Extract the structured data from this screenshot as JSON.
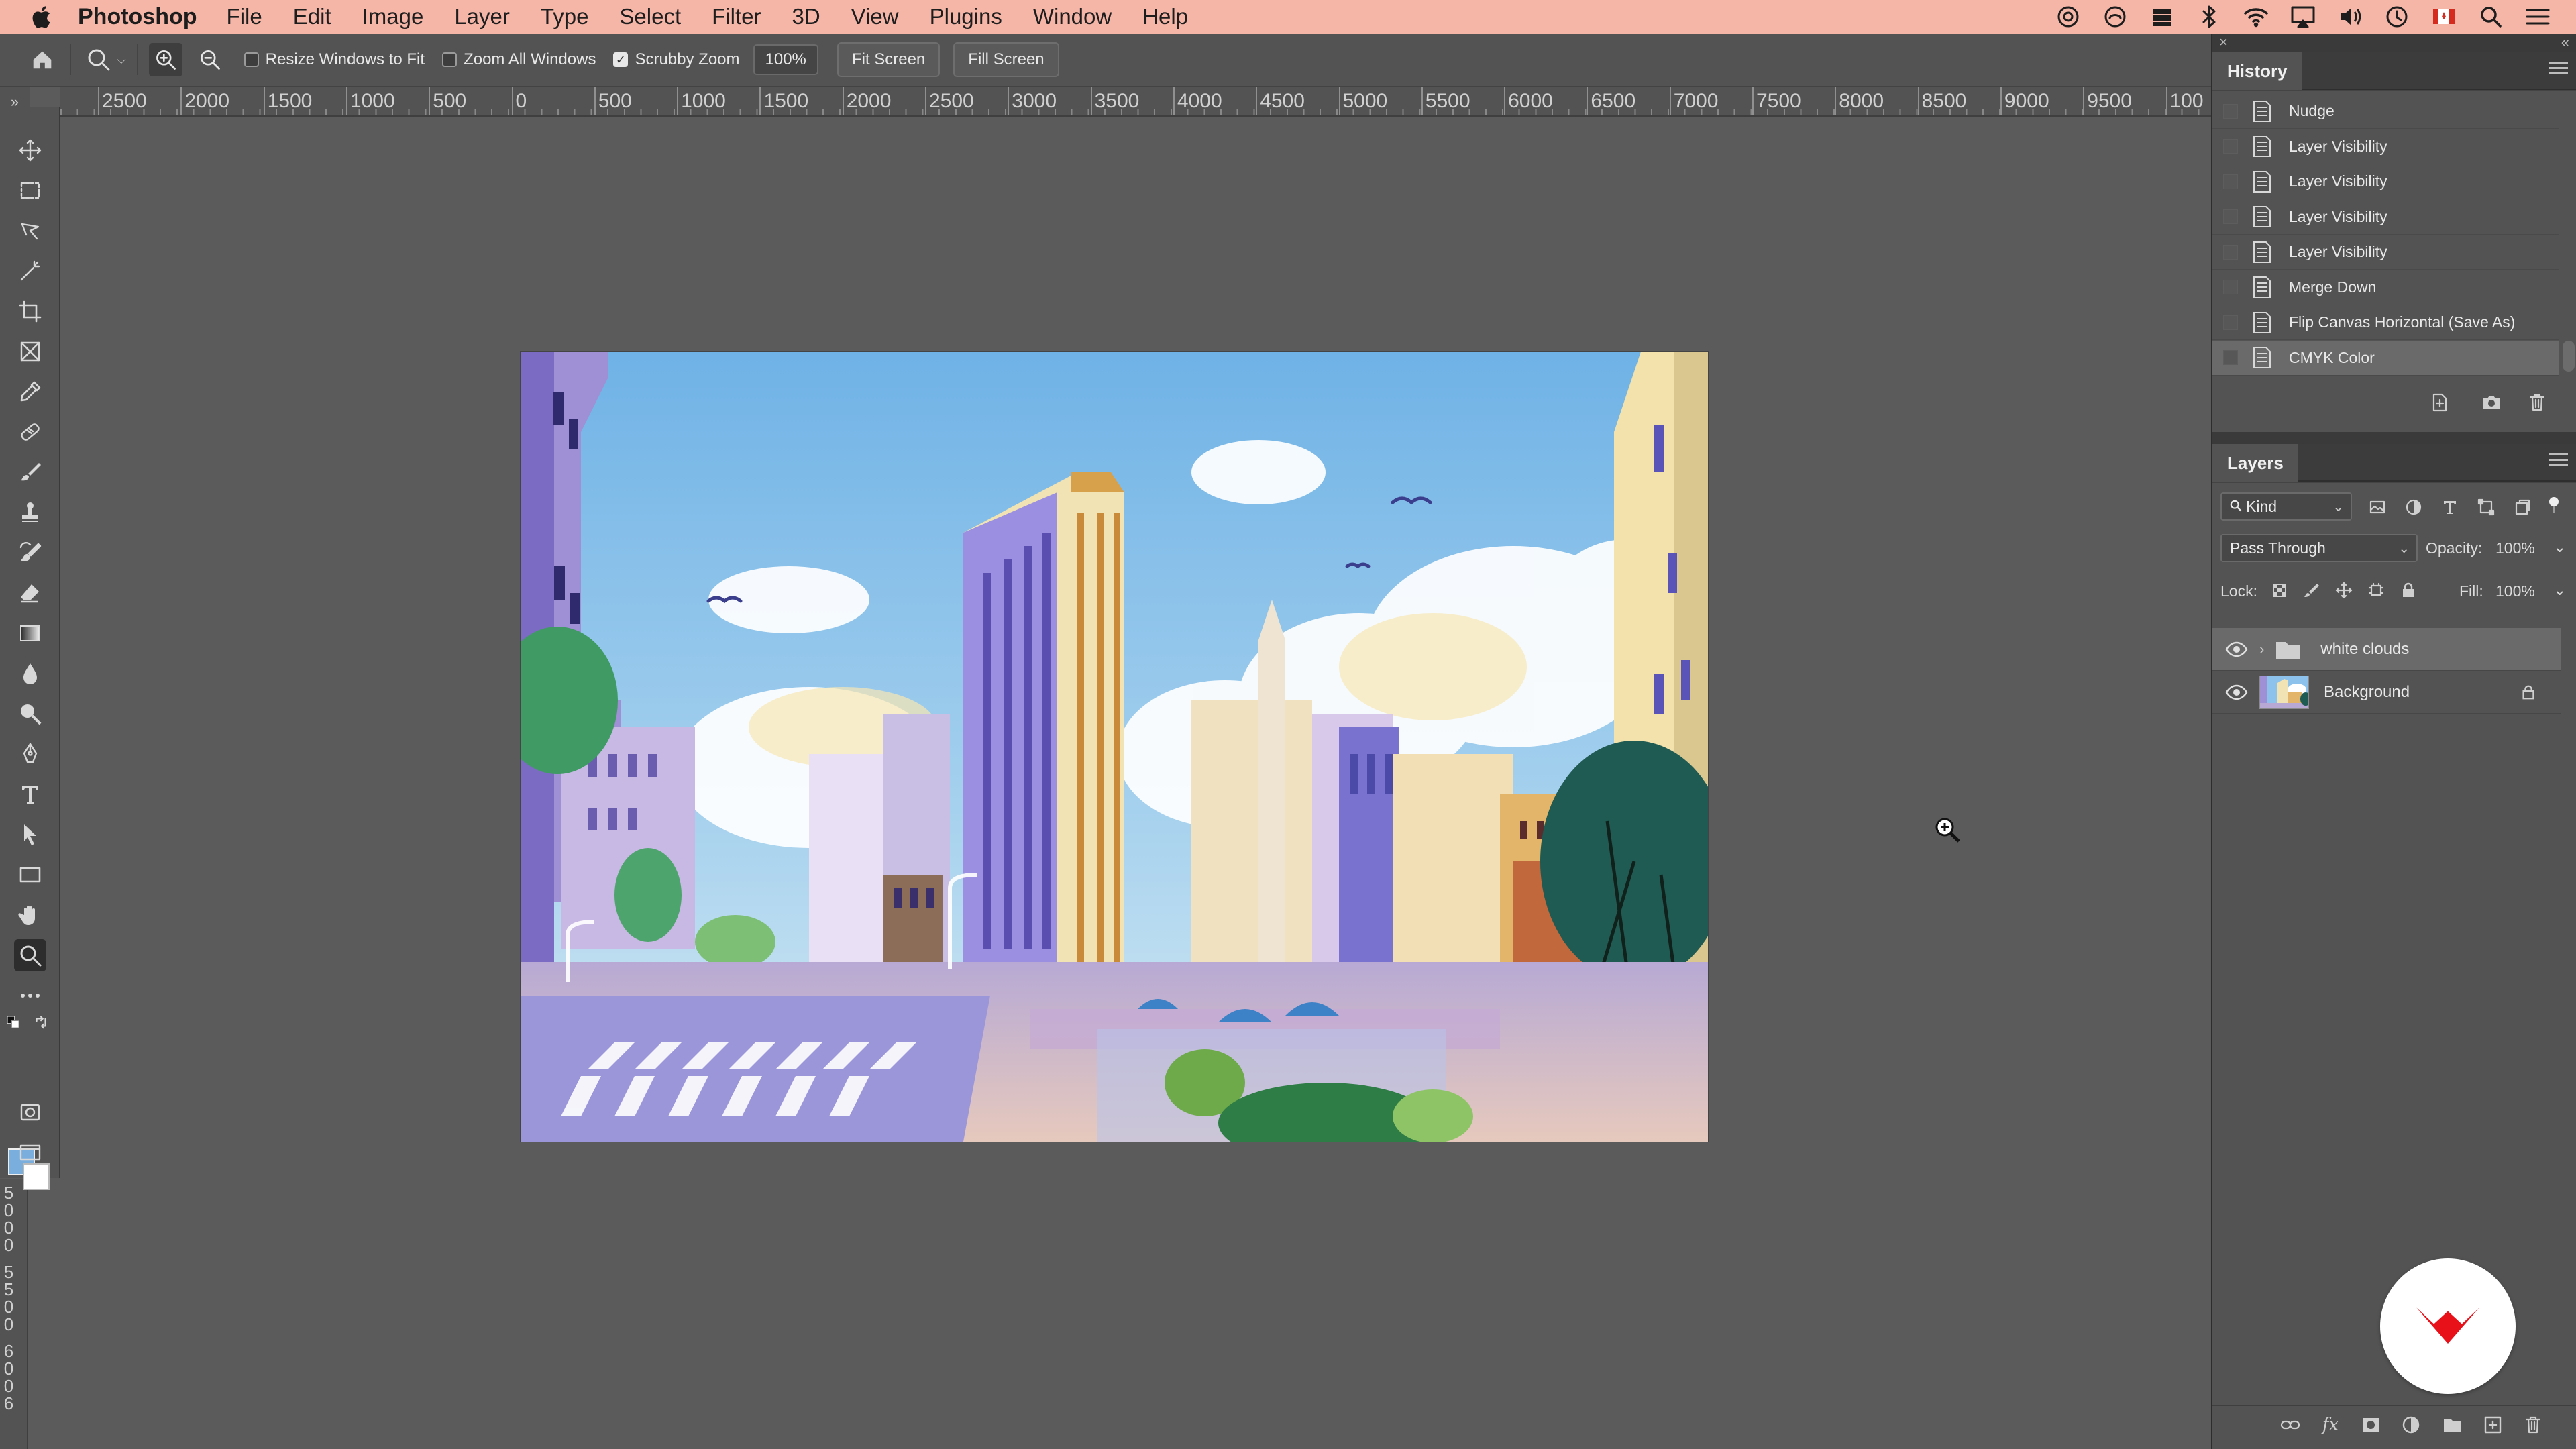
{
  "menubar": {
    "app_name": "Photoshop",
    "items": [
      "File",
      "Edit",
      "Image",
      "Layer",
      "Type",
      "Select",
      "Filter",
      "3D",
      "View",
      "Plugins",
      "Window",
      "Help"
    ]
  },
  "options_bar": {
    "resize_windows": {
      "label": "Resize Windows to Fit",
      "checked": false
    },
    "zoom_all": {
      "label": "Zoom All Windows",
      "checked": false
    },
    "scrubby": {
      "label": "Scrubby Zoom",
      "checked": true
    },
    "zoom_value": "100%",
    "fit_screen": "Fit Screen",
    "fill_screen": "Fill Screen"
  },
  "ruler": {
    "h_labels": [
      "2500",
      "2000",
      "1500",
      "1000",
      "500",
      "0",
      "500",
      "1000",
      "1500",
      "2000",
      "2500",
      "3000",
      "3500",
      "4000",
      "4500",
      "5000",
      "5500",
      "6000",
      "6500",
      "7000",
      "7500",
      "8000",
      "8500",
      "9000",
      "9500",
      "100"
    ],
    "v_digits": [
      "5",
      "0",
      "0",
      "0",
      "5",
      "5",
      "0",
      "0",
      "6",
      "0",
      "0",
      "6"
    ]
  },
  "colors": {
    "foreground": "#7aaedc",
    "background": "#ffffff",
    "menubar": "#f5b6a8",
    "logo_red": "#e8111a"
  },
  "history": {
    "title": "History",
    "items": [
      "Nudge",
      "Layer Visibility",
      "Layer Visibility",
      "Layer Visibility",
      "Layer Visibility",
      "Merge Down",
      "Flip Canvas Horizontal (Save As)",
      "CMYK Color"
    ],
    "selected_index": 7
  },
  "layers": {
    "title": "Layers",
    "filter_kind": "Kind",
    "blend_mode": "Pass Through",
    "opacity_label": "Opacity:",
    "opacity": "100%",
    "lock_label": "Lock:",
    "fill_label": "Fill:",
    "fill": "100%",
    "items": [
      {
        "name": "white clouds",
        "type": "group",
        "visible": true,
        "selected": true
      },
      {
        "name": "Background",
        "type": "image",
        "visible": true,
        "locked": true
      }
    ]
  }
}
